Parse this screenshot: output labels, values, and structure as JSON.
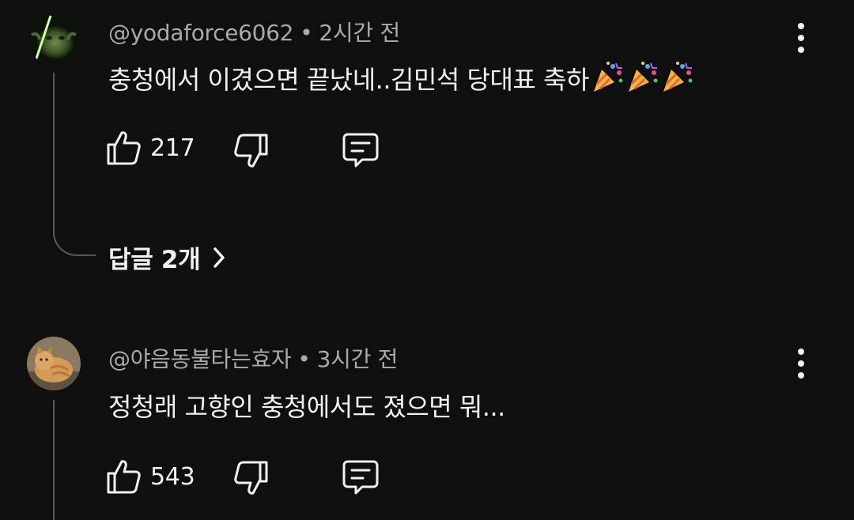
{
  "comments": [
    {
      "handle": "@yodaforce6062",
      "separator": "•",
      "time": "2시간 전",
      "text": "충청에서 이겼으면 끝났네..김민석 당대표 축하",
      "emoji": "party-popper",
      "emoji_count": 3,
      "likes": "217",
      "replies_label": "답글 2개",
      "avatar": "yoda-avatar"
    },
    {
      "handle": "@야음동불타는효자",
      "separator": "•",
      "time": "3시간 전",
      "text": "정청래 고향인 충청에서도 졌으면 뭐...",
      "likes": "543",
      "avatar": "cat-avatar"
    }
  ],
  "icons": {
    "like": "thumbs-up-icon",
    "dislike": "thumbs-down-icon",
    "reply": "reply-comment-icon",
    "menu": "more-vertical-icon",
    "chevron": "chevron-right-icon"
  },
  "colors": {
    "background": "#0f0f0f",
    "text": "#f1f1f1",
    "meta": "#aaaaaa",
    "thread": "#5a5a5a"
  }
}
